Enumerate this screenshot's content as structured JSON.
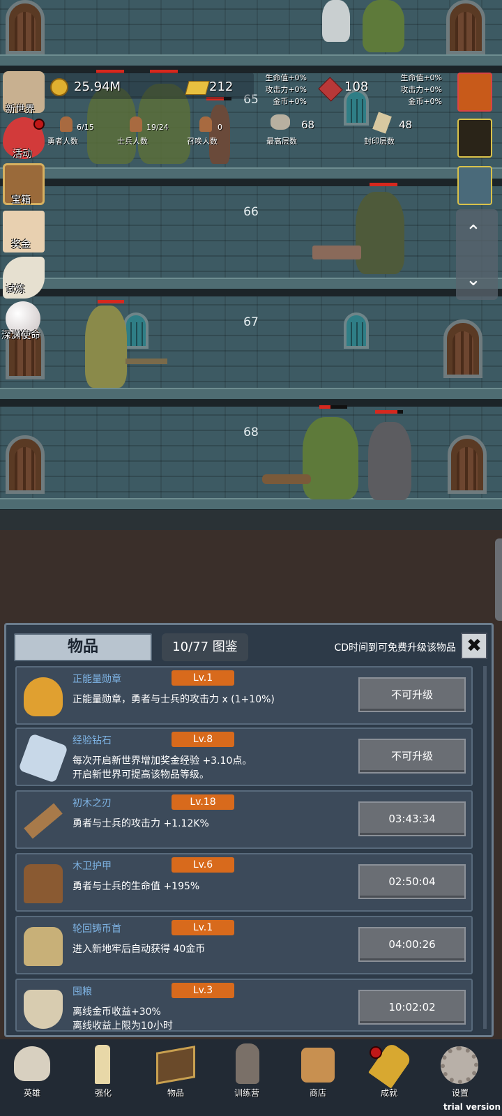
{
  "floors": [
    "65",
    "66",
    "67",
    "68"
  ],
  "hud": {
    "gold": "25.94M",
    "gold_bars": "212",
    "gems": "108",
    "bonus_left": [
      "生命值+0%",
      "攻击力+0%",
      "金币+0%"
    ],
    "bonus_right": [
      "生命值+0%",
      "攻击力+0%",
      "金币+0%"
    ],
    "heroes_count": "6/15",
    "heroes_label": "勇者人数",
    "soldiers_count": "19/24",
    "soldiers_label": "士兵人数",
    "summons_count": "0",
    "summons_label": "召唤人数",
    "top_floor": "68",
    "top_floor_label": "最高层数",
    "sealed_floor": "48",
    "sealed_floor_label": "封印层数"
  },
  "side_menu": [
    "新世界",
    "活动",
    "宝箱",
    "奖金",
    "试炼",
    "深渊使命"
  ],
  "panel": {
    "tab_label": "物品",
    "collection": "10/77 图鉴",
    "hint": "CD时间到可免费升级该物品",
    "items": [
      {
        "name": "正能量勋章",
        "level": "Lv.1",
        "desc1": "正能量勋章，勇者与士兵的攻击力 x (1+10%)",
        "desc2": "",
        "button": "不可升级",
        "icon": "crown-icon"
      },
      {
        "name": "经验钻石",
        "level": "Lv.8",
        "desc1": "每次开启新世界增加奖金经验 +3.10点。",
        "desc2": "开启新世界可提高该物品等级。",
        "button": "不可升级",
        "icon": "diamond-icon"
      },
      {
        "name": "初木之刃",
        "level": "Lv.18",
        "desc1": "勇者与士兵的攻击力 +1.12K%",
        "desc2": "",
        "button": "03:43:34",
        "icon": "wooden-sword-icon"
      },
      {
        "name": "木卫护甲",
        "level": "Lv.6",
        "desc1": "勇者与士兵的生命值 +195%",
        "desc2": "",
        "button": "02:50:04",
        "icon": "armor-icon"
      },
      {
        "name": "轮回铸币首",
        "level": "Lv.1",
        "desc1": "进入新地牢后自动获得 40金币",
        "desc2": "",
        "button": "04:00:26",
        "icon": "helmet-icon"
      },
      {
        "name": "囤粮",
        "level": "Lv.3",
        "desc1": "离线金币收益+30%",
        "desc2": "离线收益上限为10小时",
        "button": "10:02:02",
        "icon": "rice-bowl-icon"
      }
    ]
  },
  "bottom_nav": [
    "英雄",
    "强化",
    "物品",
    "训练营",
    "商店",
    "成就",
    "设置"
  ],
  "watermark": "trial version"
}
